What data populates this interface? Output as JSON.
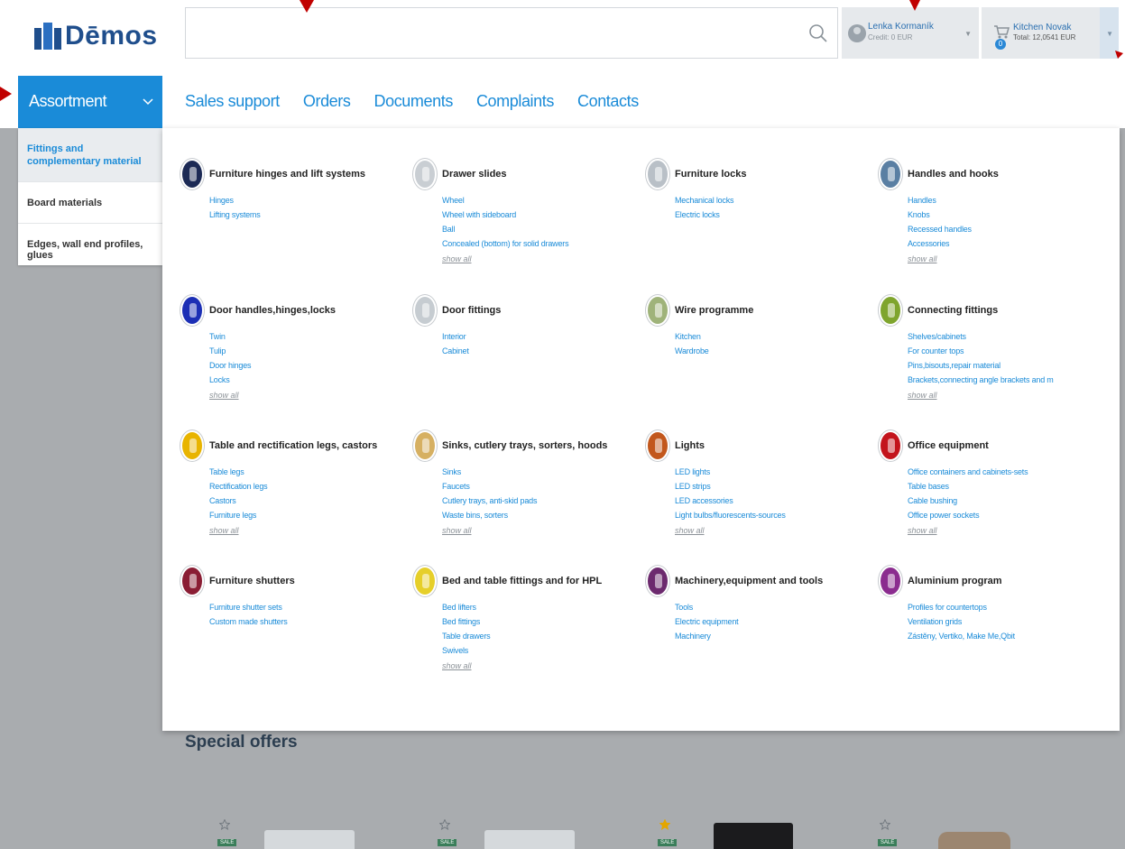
{
  "brand": {
    "name": "Dēmos"
  },
  "search": {
    "value": "",
    "placeholder": ""
  },
  "user": {
    "name": "Lenka Kormaník",
    "credit": "Credit: 0 EUR"
  },
  "cart": {
    "name": "Kitchen Novak",
    "total": "Total: 12,0541 EUR",
    "count": "0"
  },
  "nav": {
    "assortment": "Assortment",
    "links": [
      "Sales support",
      "Orders",
      "Documents",
      "Complaints",
      "Contacts"
    ]
  },
  "sidebar": {
    "items": [
      {
        "label": "Fittings and complementary material"
      },
      {
        "label": "Board materials"
      },
      {
        "label": "Edges, wall end profiles, glues"
      }
    ]
  },
  "show_all_label": "show all",
  "categories": [
    {
      "title": "Furniture hinges and lift systems",
      "icon": "hinge-icon",
      "color": "#1c2a55",
      "links": [
        "Hinges",
        "Lifting systems"
      ],
      "show_all": false
    },
    {
      "title": "Drawer slides",
      "icon": "drawer-slide-icon",
      "color": "#c9ced3",
      "links": [
        "Wheel",
        "Wheel with sideboard",
        "Ball",
        "Concealed (bottom) for solid drawers"
      ],
      "show_all": true
    },
    {
      "title": "Furniture locks",
      "icon": "lock-icon",
      "color": "#b9c0c7",
      "links": [
        "Mechanical locks",
        "Electric locks"
      ],
      "show_all": false
    },
    {
      "title": "Handles and hooks",
      "icon": "handle-icon",
      "color": "#5a7fa3",
      "links": [
        "Handles",
        "Knobs",
        "Recessed handles",
        "Accessories"
      ],
      "show_all": true
    },
    {
      "title": "Door handles,hinges,locks",
      "icon": "door-handle-icon",
      "color": "#1c2fb5",
      "links": [
        "Twin",
        "Tulip",
        "Door hinges",
        "Locks"
      ],
      "show_all": true
    },
    {
      "title": "Door fittings",
      "icon": "door-fitting-icon",
      "color": "#c6ccd1",
      "links": [
        "Interior",
        "Cabinet"
      ],
      "show_all": false
    },
    {
      "title": "Wire programme",
      "icon": "wire-icon",
      "color": "#9fb37a",
      "links": [
        "Kitchen",
        "Wardrobe"
      ],
      "show_all": false
    },
    {
      "title": "Connecting fittings",
      "icon": "connector-icon",
      "color": "#7fa52e",
      "links": [
        "Shelves/cabinets",
        "For counter tops",
        "Pins,bisouts,repair material",
        "Brackets,connecting angle brackets and m"
      ],
      "show_all": true
    },
    {
      "title": "Table and rectification legs, castors",
      "icon": "table-leg-icon",
      "color": "#e8b400",
      "links": [
        "Table legs",
        "Rectification legs",
        "Castors",
        "Furniture legs"
      ],
      "show_all": true
    },
    {
      "title": "Sinks, cutlery trays, sorters, hoods",
      "icon": "sink-icon",
      "color": "#d6b062",
      "links": [
        "Sinks",
        "Faucets",
        "Cutlery trays, anti-skid pads",
        "Waste bins, sorters"
      ],
      "show_all": true
    },
    {
      "title": "Lights",
      "icon": "light-icon",
      "color": "#c2571c",
      "links": [
        "LED lights",
        "LED strips",
        "LED accessories",
        "Light bulbs/fluorescents-sources"
      ],
      "show_all": true
    },
    {
      "title": "Office equipment",
      "icon": "office-icon",
      "color": "#c3141c",
      "links": [
        "Office containers and cabinets-sets",
        "Table bases",
        "Cable bushing",
        "Office power sockets"
      ],
      "show_all": true
    },
    {
      "title": "Furniture shutters",
      "icon": "shutter-icon",
      "color": "#8a1d34",
      "links": [
        "Furniture shutter sets",
        "Custom made shutters"
      ],
      "show_all": false
    },
    {
      "title": "Bed and table fittings and for HPL",
      "icon": "bed-icon",
      "color": "#e6cf2a",
      "links": [
        "Bed lifters",
        "Bed fittings",
        "Table drawers",
        "Swivels"
      ],
      "show_all": true
    },
    {
      "title": "Machinery,equipment and tools",
      "icon": "tools-icon",
      "color": "#6c2a6e",
      "links": [
        "Tools",
        "Electric equipment",
        "Machinery"
      ],
      "show_all": false
    },
    {
      "title": "Aluminium program",
      "icon": "aluminium-icon",
      "color": "#8b2c8f",
      "links": [
        "Profiles for countertops",
        "Ventilation grids",
        "Zástěny, Vertiko, Make Me,Qbit"
      ],
      "show_all": false
    }
  ],
  "offers": {
    "title": "Special offers",
    "sale_label": "SALE",
    "items": [
      {
        "starred": false,
        "image": "light-gray"
      },
      {
        "starred": false,
        "image": "light-gray"
      },
      {
        "starred": true,
        "image": "dark"
      },
      {
        "starred": false,
        "image": "wood"
      }
    ]
  },
  "colors": {
    "accent": "#1a8bd8",
    "brand": "#1f4e8c",
    "annotation": "#c00000"
  }
}
